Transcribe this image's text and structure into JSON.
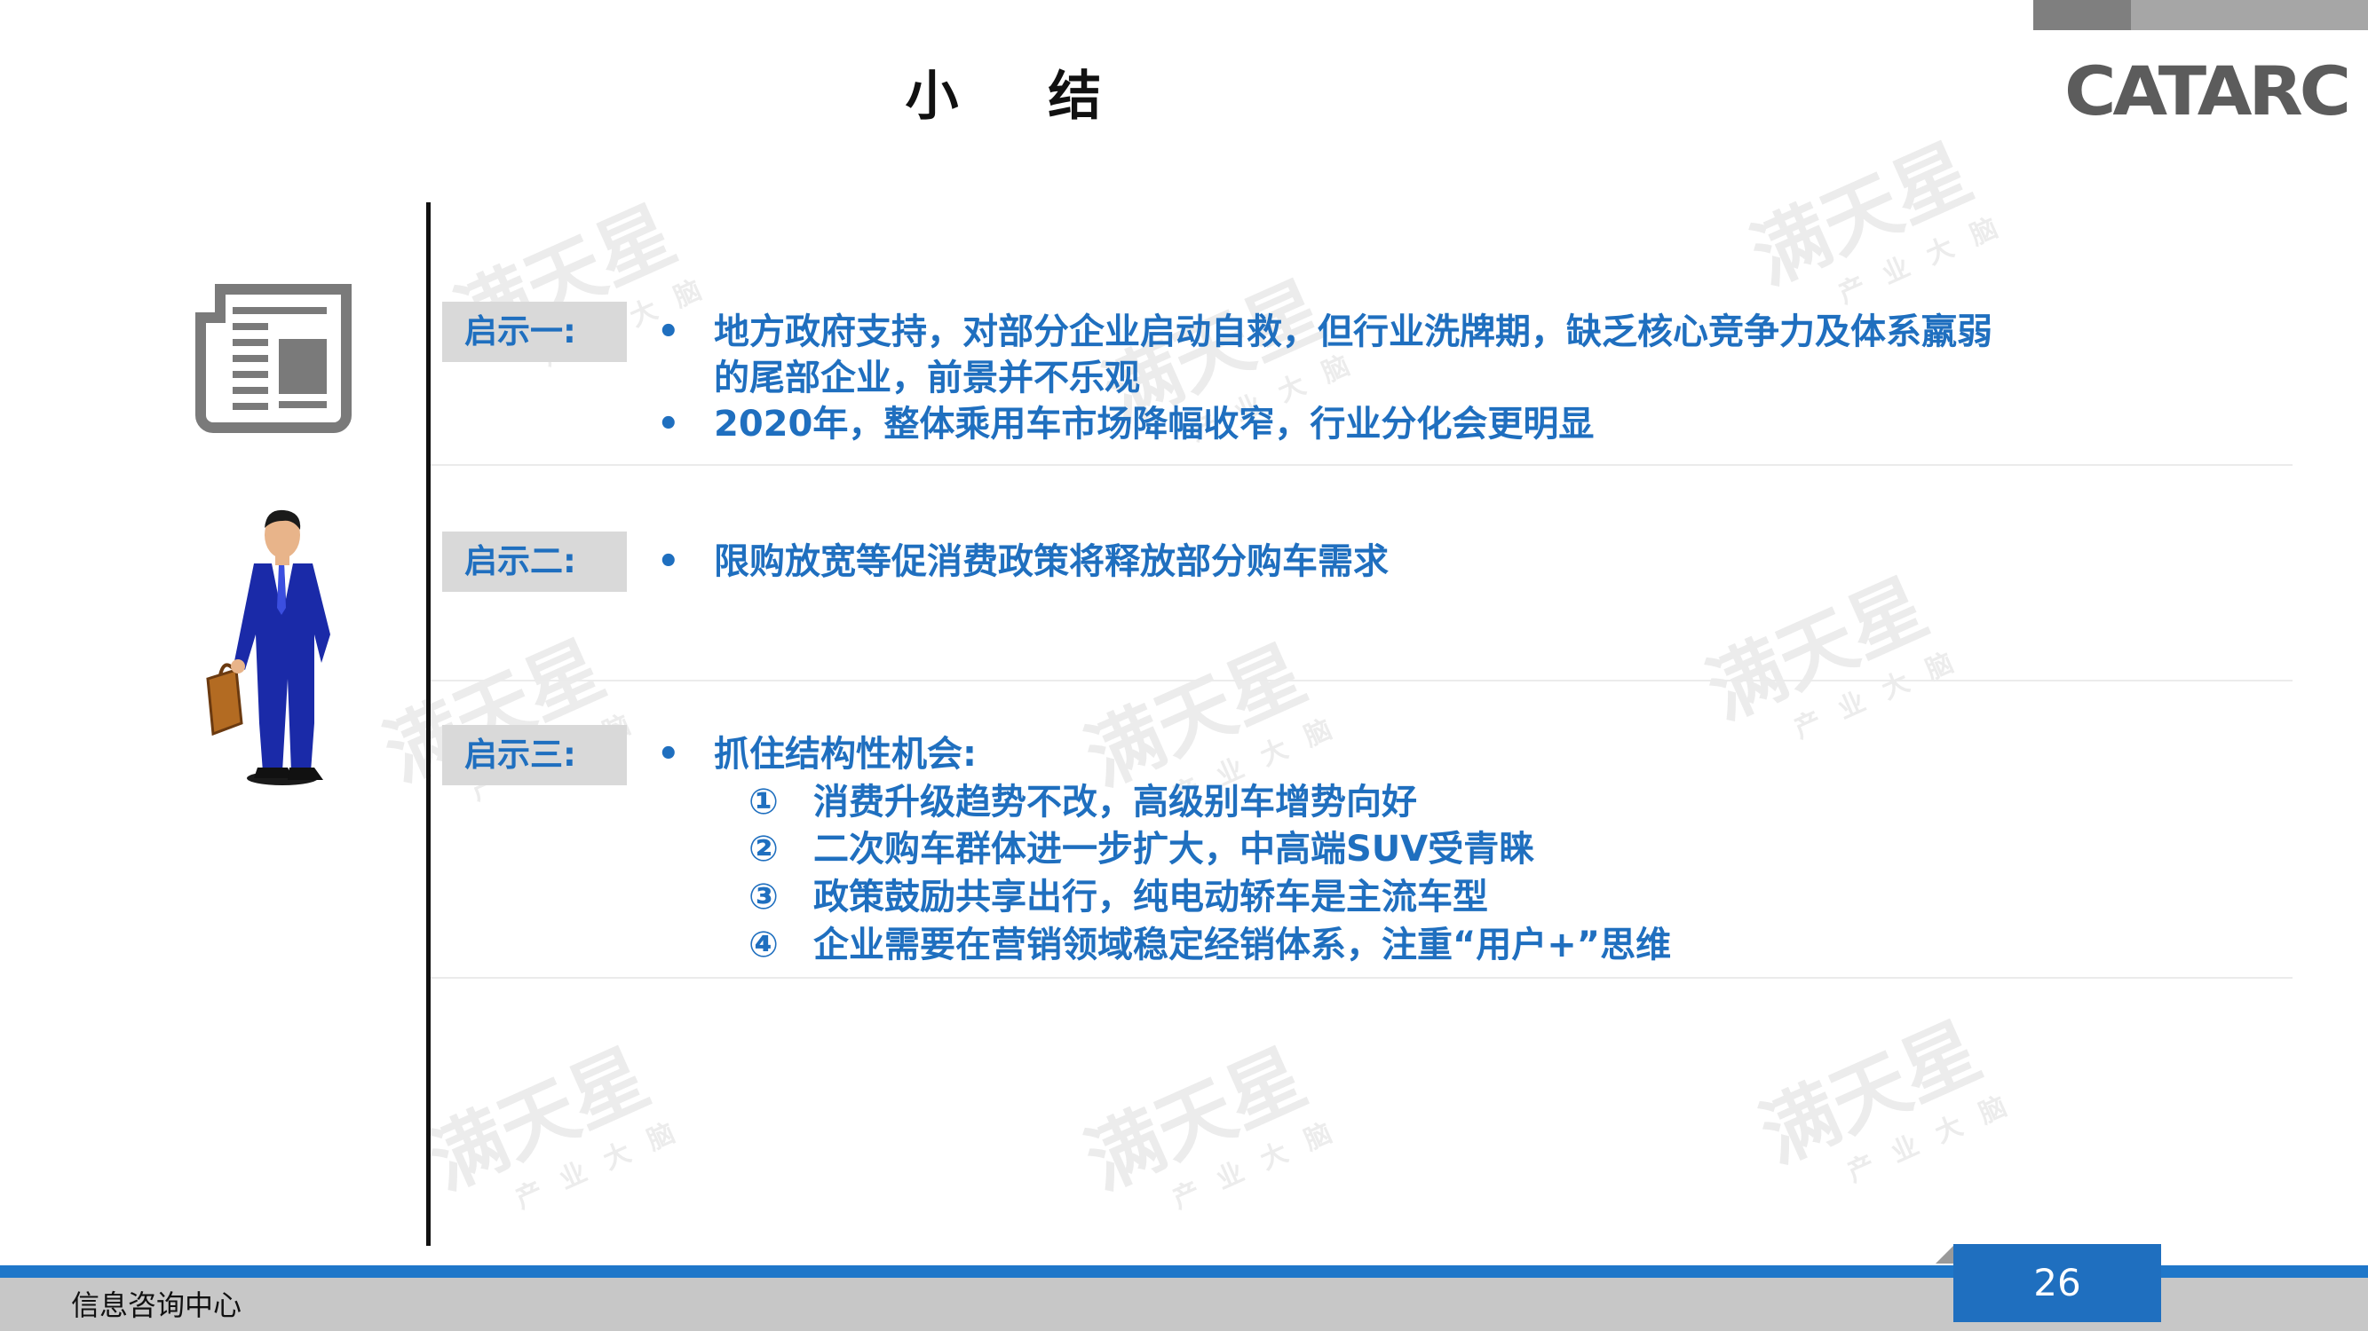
{
  "header": {
    "title": "小 结",
    "logo": "CATARC"
  },
  "sections": [
    {
      "label": "启示一:",
      "bullets": [
        {
          "line1": "地方政府支持，对部分企业启动自救，但行业洗牌期，缺乏核心竞争力及体系羸弱",
          "line2": "的尾部企业，前景并不乐观"
        },
        {
          "line1": "2020年，整体乘用车市场降幅收窄，行业分化会更明显"
        }
      ]
    },
    {
      "label": "启示二:",
      "bullets": [
        {
          "line1": "限购放宽等促消费政策将释放部分购车需求"
        }
      ]
    },
    {
      "label": "启示三:",
      "bullets": [
        {
          "line1": "抓住结构性机会:"
        }
      ],
      "items": [
        {
          "num": "①",
          "text": "消费升级趋势不改，高级别车增势向好"
        },
        {
          "num": "②",
          "text": "二次购车群体进一步扩大，中高端SUV受青睐"
        },
        {
          "num": "③",
          "text": "政策鼓励共享出行，纯电动轿车是主流车型"
        },
        {
          "num": "④",
          "text": "企业需要在营销领域稳定经销体系，注重“用户+”思维"
        }
      ]
    }
  ],
  "bullet_symbol": "•",
  "watermark": {
    "main": "满天星",
    "sub": "产业大脑"
  },
  "footer": {
    "org": "信息咨询中心",
    "page": "26"
  },
  "colors": {
    "accent": "#1f6fbf",
    "label_bg": "#d9d9d9",
    "footer_blue": "#1f77c9"
  },
  "icons": [
    "newspaper-icon",
    "businessman-icon"
  ]
}
